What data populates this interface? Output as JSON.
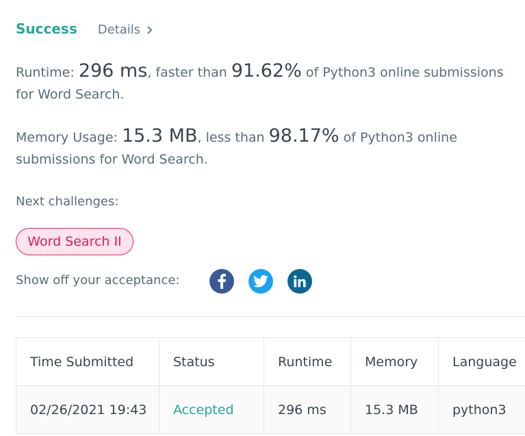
{
  "header": {
    "status": "Success",
    "details_label": "Details"
  },
  "runtime": {
    "prefix": "Runtime: ",
    "value": "296 ms",
    "middle": ", faster than ",
    "percent": "91.62%",
    "suffix": " of Python3 online submissions for Word Search."
  },
  "memory": {
    "prefix": "Memory Usage: ",
    "value": "15.3 MB",
    "middle": ", less than ",
    "percent": "98.17%",
    "suffix": " of Python3 online submissions for Word Search."
  },
  "next": {
    "label": "Next challenges:",
    "items": [
      "Word Search II"
    ]
  },
  "share": {
    "label": "Show off your acceptance:",
    "icons": [
      "facebook-icon",
      "twitter-icon",
      "linkedin-icon"
    ],
    "colors": {
      "facebook": "#3b5998",
      "twitter": "#1da1f2",
      "linkedin": "#0e6695"
    }
  },
  "table": {
    "headers": [
      "Time Submitted",
      "Status",
      "Runtime",
      "Memory",
      "Language"
    ],
    "rows": [
      [
        "02/26/2021 19:43",
        "Accepted",
        "296 ms",
        "15.3 MB",
        "python3"
      ]
    ]
  },
  "colors": {
    "success": "#26a69a",
    "challenge_pill": "#e91e63"
  }
}
